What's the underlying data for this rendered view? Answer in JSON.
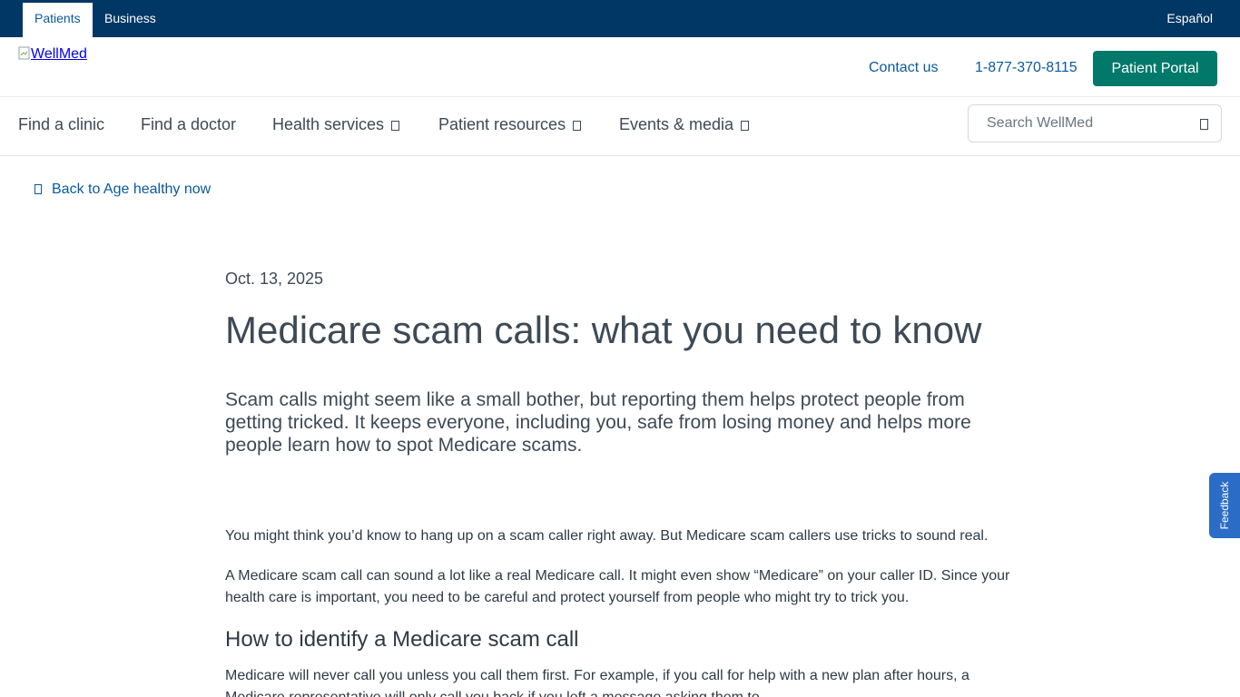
{
  "topbar": {
    "tabs": [
      {
        "label": "Patients",
        "active": true
      },
      {
        "label": "Business",
        "active": false
      }
    ],
    "language": "Español"
  },
  "header": {
    "logo_alt": "WellMed",
    "contact": "Contact us",
    "phone": "1-877-370-8115",
    "portal": "Patient Portal"
  },
  "nav": {
    "items": [
      {
        "label": "Find a clinic"
      },
      {
        "label": "Find a doctor"
      },
      {
        "label": "Health services"
      },
      {
        "label": "Patient resources"
      },
      {
        "label": "Events & media"
      }
    ],
    "search_placeholder": "Search WellMed"
  },
  "back_link": "Back to Age healthy now",
  "article": {
    "date": "Oct. 13, 2025",
    "title": "Medicare scam calls: what you need to know",
    "lede": "Scam calls might seem like a small bother, but reporting them helps protect people from getting tricked. It keeps everyone, including you, safe from losing money and helps more people learn how to spot Medicare scams.",
    "paragraph1": "You might think you’d know to hang up on a scam caller right away. But Medicare scam callers use tricks to sound real.",
    "paragraph2": "A Medicare scam call can sound a lot like a real Medicare call. It might even show “Medicare” on your caller ID. Since your health care is important, you need to be careful and protect yourself from people who might try to trick you.",
    "heading2": "How to identify a Medicare scam call",
    "paragraph3": "Medicare will never call you unless you call them first. For example, if you call for help with a new plan after hours, a Medicare representative will only call you back if you left a message asking them to."
  },
  "feedback": "Feedback",
  "colors": {
    "topbar": "#003764",
    "link": "#0a5a9c",
    "portal_button": "#00796b",
    "feedback_tab": "#2b6dc6",
    "text": "#3d4a56"
  }
}
